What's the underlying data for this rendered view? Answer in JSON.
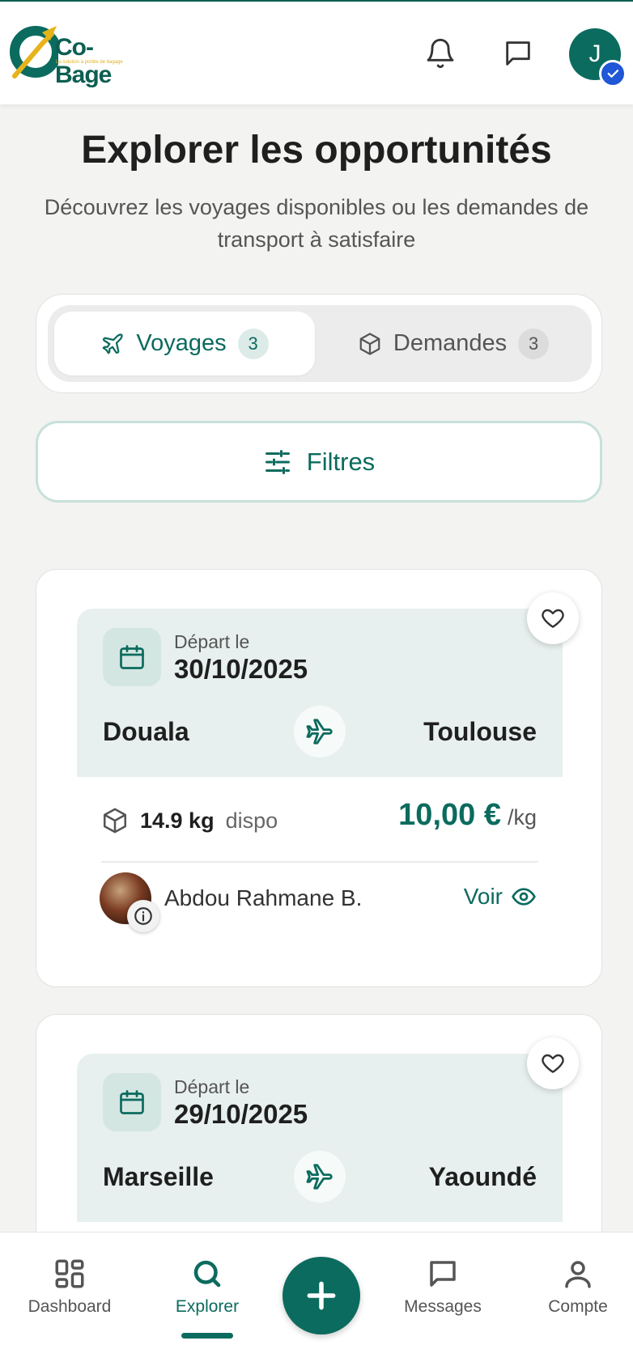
{
  "header": {
    "brand_name": "Co-Bage",
    "brand_tagline": "La solution à portée de bagage",
    "avatar_initial": "J"
  },
  "page": {
    "title": "Explorer les opportunités",
    "subtitle": "Découvrez les voyages disponibles ou les demandes de transport à satisfaire"
  },
  "tabs": [
    {
      "label": "Voyages",
      "count": "3",
      "icon": "plane-icon",
      "active": true
    },
    {
      "label": "Demandes",
      "count": "3",
      "icon": "package-icon",
      "active": false
    }
  ],
  "filters": {
    "label": "Filtres"
  },
  "cards": [
    {
      "departure_label": "Départ le",
      "departure_date": "30/10/2025",
      "from": "Douala",
      "to": "Toulouse",
      "kg_value": "14.9 kg",
      "kg_suffix": "dispo",
      "price": "10,00 €",
      "price_unit": "/kg",
      "traveler": "Abdou Rahmane B.",
      "action": "Voir"
    },
    {
      "departure_label": "Départ le",
      "departure_date": "29/10/2025",
      "from": "Marseille",
      "to": "Yaoundé"
    }
  ],
  "nav": [
    {
      "label": "Dashboard",
      "icon": "dashboard-icon",
      "active": false
    },
    {
      "label": "Explorer",
      "icon": "search-icon",
      "active": true
    },
    {
      "label": "Messages",
      "icon": "message-icon",
      "active": false
    },
    {
      "label": "Compte",
      "icon": "user-icon",
      "active": false
    }
  ],
  "colors": {
    "primary": "#0b6b5e",
    "route_bg": "#e7f0ee",
    "verified": "#1f57d6",
    "logo_accent": "#e6b31a"
  }
}
